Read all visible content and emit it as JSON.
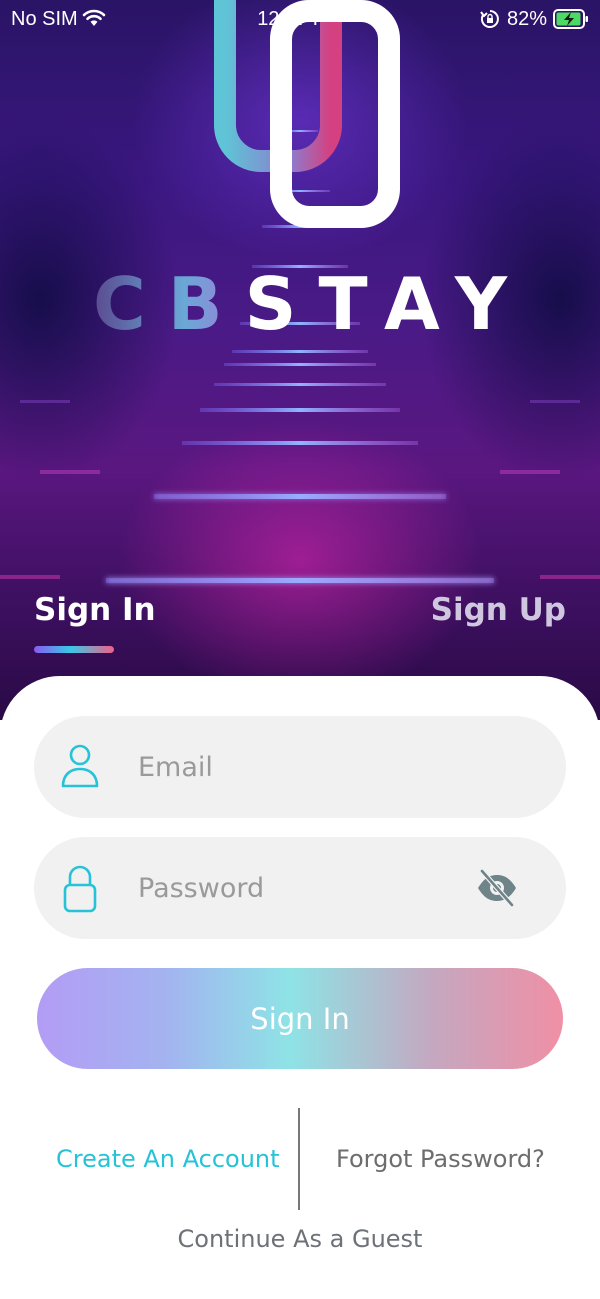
{
  "status_bar": {
    "carrier": "No SIM",
    "time": "12:37 PM",
    "battery_percent": "82%",
    "battery_level": 0.82,
    "icons": [
      "wifi-icon",
      "orientation-lock-icon",
      "battery-charging-icon"
    ]
  },
  "brand": {
    "name_part_1": "CB",
    "name_part_2": "STAY",
    "logo_icon": "cbstay-logo-icon"
  },
  "auth_tabs": {
    "sign_in": "Sign In",
    "sign_up": "Sign Up",
    "active": "sign_in"
  },
  "form": {
    "email_placeholder": "Email",
    "email_value": "",
    "email_icon": "user-icon",
    "password_placeholder": "Password",
    "password_value": "",
    "password_icon": "lock-icon",
    "visibility_icon": "eye-off-icon",
    "submit_label": "Sign In"
  },
  "links": {
    "create_account": "Create An Account",
    "forgot_password": "Forgot Password?",
    "guest": "Continue As a Guest"
  },
  "colors": {
    "accent_cyan": "#25c2d8",
    "gradient_start": "#b39cf5",
    "gradient_mid": "#8ee3e6",
    "gradient_end": "#f08fa5",
    "hero_dark": "#2a1466"
  }
}
